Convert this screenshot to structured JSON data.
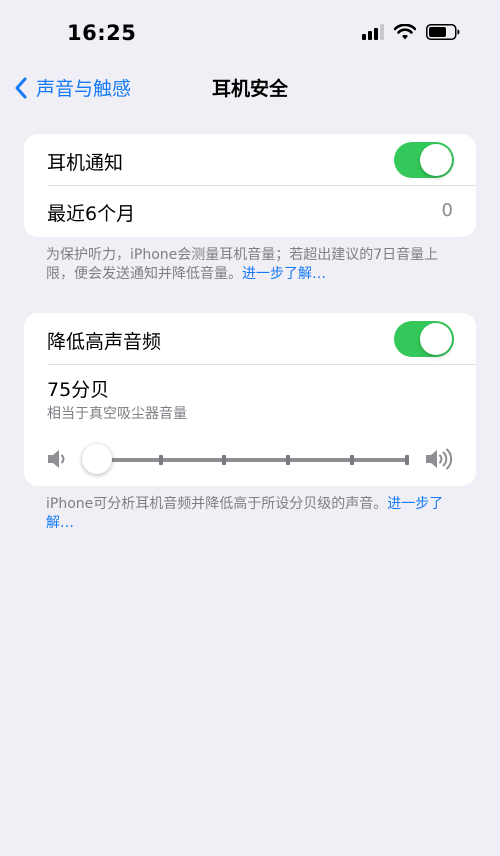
{
  "status_bar": {
    "time": "16:25"
  },
  "nav": {
    "back_label": "声音与触感",
    "title": "耳机安全"
  },
  "notifications_card": {
    "toggle_label": "耳机通知",
    "toggle_on": true,
    "recent_label": "最近6个月",
    "recent_value": "0"
  },
  "notifications_footer": {
    "text": "为保护听力，iPhone会测量耳机音量；若超出建议的7日音量上限，便会发送通知并降低音量。",
    "link": "进一步了解…"
  },
  "reduce_card": {
    "toggle_label": "降低高声音频",
    "toggle_on": true,
    "level_value": "75分贝",
    "level_description": "相当于真空吸尘器音量",
    "slider_level_fraction": 0
  },
  "reduce_footer": {
    "text": "iPhone可分析耳机音频并降低高于所设分贝级的声音。",
    "link": "进一步了解…"
  },
  "colors": {
    "accent": "#157af6",
    "toggle_on": "#34c759",
    "background": "#f0eff6"
  },
  "icons": [
    "cellular-signal-icon",
    "wifi-icon",
    "battery-icon",
    "chevron-left-icon",
    "volume-low-icon",
    "volume-high-icon"
  ]
}
